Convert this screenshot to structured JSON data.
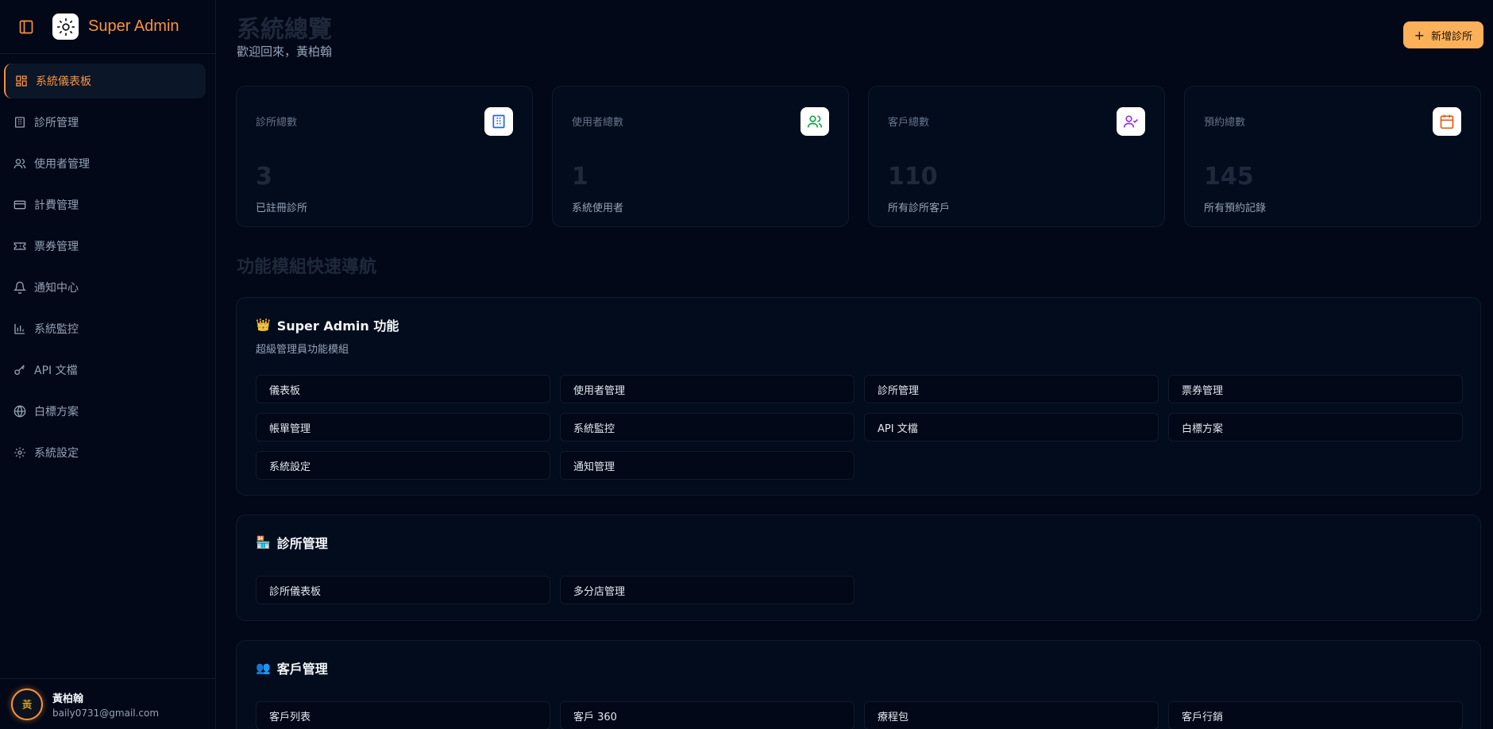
{
  "app": {
    "title": "Super Admin"
  },
  "sidebar": {
    "items": [
      {
        "label": "系統儀表板",
        "icon": "grid-icon",
        "active": true
      },
      {
        "label": "診所管理",
        "icon": "building-icon"
      },
      {
        "label": "使用者管理",
        "icon": "users-icon"
      },
      {
        "label": "計費管理",
        "icon": "credit-card-icon"
      },
      {
        "label": "票券管理",
        "icon": "ticket-icon"
      },
      {
        "label": "通知中心",
        "icon": "bell-icon"
      },
      {
        "label": "系統監控",
        "icon": "bar-chart-icon"
      },
      {
        "label": "API 文檔",
        "icon": "key-icon"
      },
      {
        "label": "白標方案",
        "icon": "globe-icon"
      },
      {
        "label": "系統設定",
        "icon": "gear-icon"
      }
    ],
    "user": {
      "avatar": "黃",
      "name": "黃柏翰",
      "email": "baily0731@gmail.com"
    }
  },
  "header": {
    "title": "系統總覽",
    "subtitle": "歡迎回來，黃柏翰",
    "add_button": "新增診所"
  },
  "stats": [
    {
      "label": "診所總數",
      "value": "3",
      "desc": "已註冊診所",
      "icon": "building-icon",
      "color": "#2563eb"
    },
    {
      "label": "使用者總數",
      "value": "1",
      "desc": "系統使用者",
      "icon": "users-icon",
      "color": "#16a34a"
    },
    {
      "label": "客戶總數",
      "value": "110",
      "desc": "所有診所客戶",
      "icon": "user-check-icon",
      "color": "#9333ea"
    },
    {
      "label": "預約總數",
      "value": "145",
      "desc": "所有預約記錄",
      "icon": "calendar-icon",
      "color": "#ea580c"
    }
  ],
  "nav_section_title": "功能模組快速導航",
  "modules": [
    {
      "emoji": "👑",
      "title": "Super Admin 功能",
      "subtitle": "超級管理員功能模組",
      "items": [
        "儀表板",
        "使用者管理",
        "診所管理",
        "票券管理",
        "帳單管理",
        "系統監控",
        "API 文檔",
        "白標方案",
        "系統設定",
        "通知管理"
      ]
    },
    {
      "emoji": "🏪",
      "title": "診所管理",
      "subtitle": "",
      "items": [
        "診所儀表板",
        "多分店管理"
      ]
    },
    {
      "emoji": "👥",
      "title": "客戶管理",
      "subtitle": "",
      "items": [
        "客戶列表",
        "客戶 360",
        "療程包",
        "客戶行銷"
      ]
    }
  ]
}
